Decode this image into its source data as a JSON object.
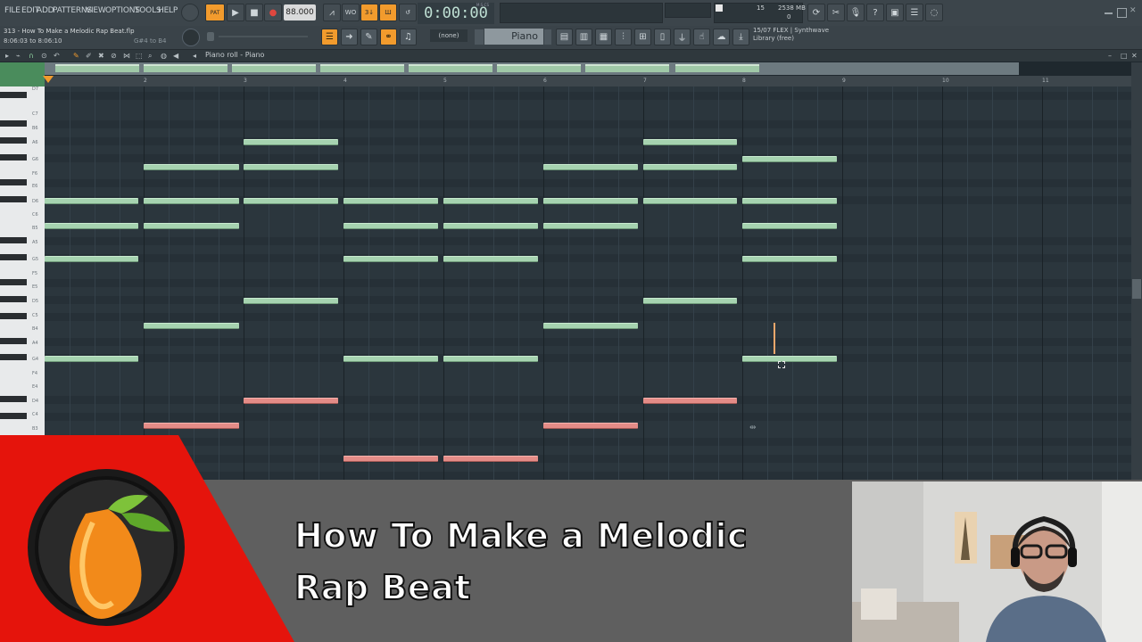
{
  "menu": [
    "FILE",
    "EDIT",
    "ADD",
    "PATTERNS",
    "VIEW",
    "OPTIONS",
    "TOOLS",
    "HELP"
  ],
  "transport": {
    "tempo": "88.000",
    "time": "0:00:00",
    "time_label": "M:S:CS",
    "cpu": "15",
    "memory": "2538 MB",
    "memory_sub": "0"
  },
  "project": {
    "name": "313 - How To Make a Melodic Rap Beat.flp",
    "time_range": "8:06:03 to 8:06:10",
    "key_range": "G#4 to B4"
  },
  "toolbar2": {
    "pattern": "(none)",
    "channel": "Piano",
    "plugin_line1": "15/07  FLEX | Synthwave",
    "plugin_line2": "Library (free)"
  },
  "pianoroll": {
    "title": "Piano roll - Piano"
  },
  "bar_numbers": [
    "2",
    "3",
    "4",
    "5",
    "6",
    "7",
    "8",
    "9",
    "10",
    "11"
  ],
  "key_labels": [
    "D7",
    "C7",
    "B6",
    "A6",
    "G6",
    "F6",
    "E6",
    "D6",
    "C6",
    "B5",
    "A5",
    "G5",
    "F5",
    "E5",
    "D5",
    "C5",
    "B4",
    "A4",
    "G4",
    "F4",
    "E4",
    "D4",
    "C4",
    "B3"
  ],
  "thumbnail": {
    "title_line1": "How To Make a Melodic",
    "title_line2": "Rap Beat"
  },
  "colors": {
    "note_green": "#a6d3b0",
    "note_red": "#e48c87",
    "accent_orange": "#f29b2d",
    "banner_red": "#e5140c"
  }
}
